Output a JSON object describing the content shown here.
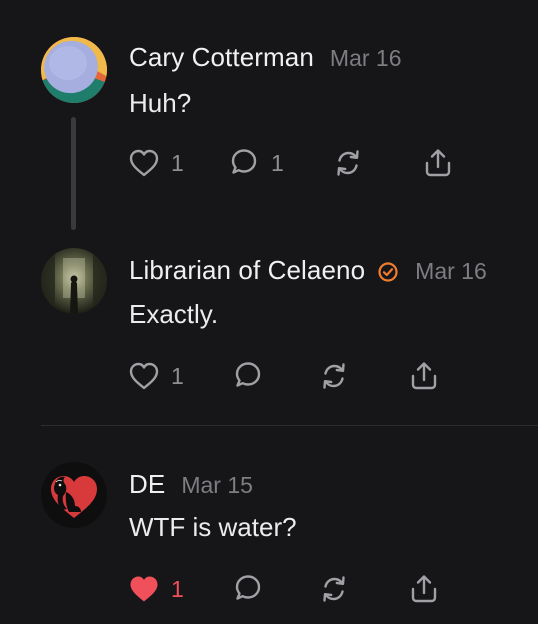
{
  "posts": [
    {
      "author": "Cary Cotterman",
      "date": "Mar 16",
      "text": "Huh?",
      "verified": false,
      "likes": "1",
      "replies": "1",
      "liked": false
    },
    {
      "author": "Librarian of Celaeno",
      "date": "Mar 16",
      "text": "Exactly.",
      "verified": true,
      "likes": "1",
      "replies": "",
      "liked": false
    },
    {
      "author": "DE",
      "date": "Mar 15",
      "text": "WTF is water?",
      "verified": false,
      "likes": "1",
      "replies": "",
      "liked": true
    }
  ],
  "icons": {
    "like": "heart-icon",
    "reply": "comment-bubble-icon",
    "repost": "repost-icon",
    "share": "share-icon",
    "verified": "verified-check-icon"
  },
  "colors": {
    "background": "#161618",
    "text_primary": "#ececee",
    "text_muted": "#7d7d82",
    "icon_gray": "#8e8e93",
    "liked_red": "#f0505a",
    "verified_orange": "#ef7d2d"
  }
}
